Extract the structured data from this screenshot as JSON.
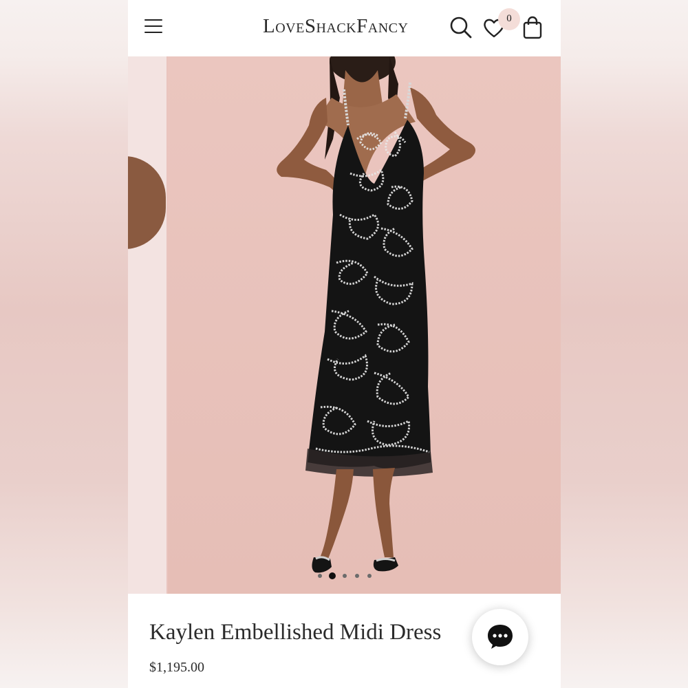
{
  "header": {
    "menu_icon": "hamburger-menu-icon",
    "logo": "LoveShackFancy",
    "search_icon": "search-icon",
    "wishlist_icon": "heart-icon",
    "wishlist_count": "0",
    "cart_icon": "shopping-bag-icon"
  },
  "gallery": {
    "slide_count": 5,
    "active_index": 1
  },
  "product": {
    "title": "Kaylen Embellished Midi Dress",
    "price": "$1,195.00"
  },
  "chat": {
    "icon": "chat-bubble-icon"
  },
  "colors": {
    "background_pink": "#e9c4be",
    "text": "#2b2b2b",
    "badge": "#f4ddd8"
  }
}
